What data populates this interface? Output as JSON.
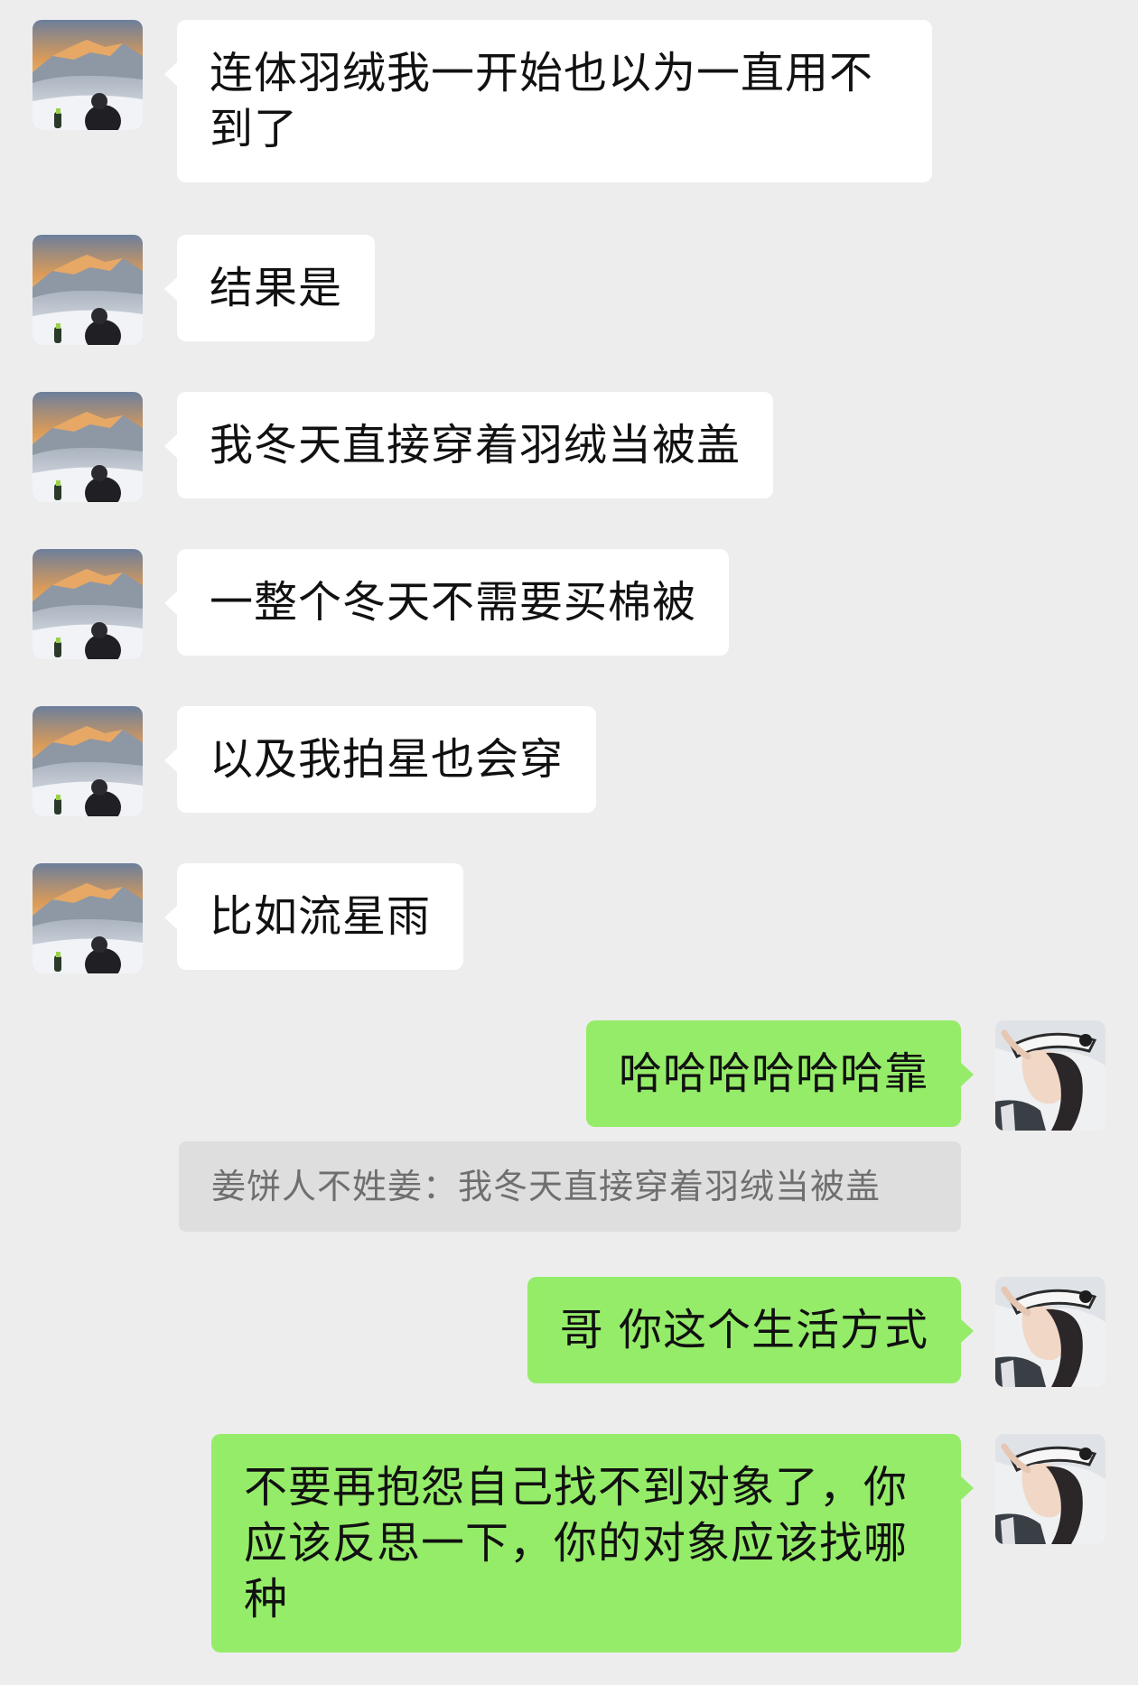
{
  "colors": {
    "background": "#ededed",
    "incoming_bubble": "#ffffff",
    "outgoing_bubble": "#95ec69",
    "quote_bg": "#dedede"
  },
  "icons": {
    "contact_avatar": "snowy-mountain-sunset-photo",
    "self_avatar": "woman-in-hat-photo"
  },
  "messages": [
    {
      "side": "incoming",
      "text": "连体羽绒我一开始也以为一直用不到了"
    },
    {
      "side": "incoming",
      "text": "结果是"
    },
    {
      "side": "incoming",
      "text": "我冬天直接穿着羽绒当被盖"
    },
    {
      "side": "incoming",
      "text": "一整个冬天不需要买棉被"
    },
    {
      "side": "incoming",
      "text": "以及我拍星也会穿"
    },
    {
      "side": "incoming",
      "text": "比如流星雨"
    },
    {
      "side": "outgoing",
      "text": "哈哈哈哈哈哈靠"
    },
    {
      "side": "outgoing",
      "text": "哥 你这个生活方式"
    },
    {
      "side": "outgoing",
      "text": "不要再抱怨自己找不到对象了，你应该反思一下，你的对象应该找哪种"
    }
  ],
  "quote": {
    "text": "姜饼人不姓姜：我冬天直接穿着羽绒当被盖"
  }
}
